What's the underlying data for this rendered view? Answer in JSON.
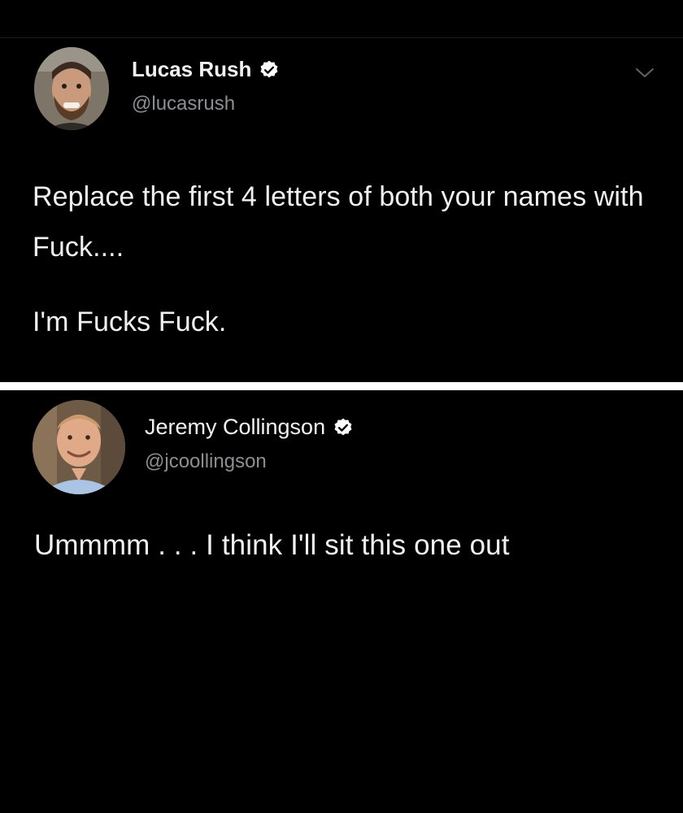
{
  "tweets": [
    {
      "display_name": "Lucas Rush",
      "handle": "@lucasrush",
      "verified": true,
      "text_lines": [
        "Replace the first 4 letters of both your names with Fuck....",
        "I'm Fucks Fuck."
      ]
    },
    {
      "display_name": "Jeremy Collingson",
      "handle": "@jcoollingson",
      "verified": true,
      "text_lines": [
        "Ummmm . . . I think I'll sit this one out"
      ]
    }
  ],
  "colors": {
    "background": "#000000",
    "text": "#f0f0f0",
    "handle": "#8b8f93",
    "divider": "#ffffff",
    "verified_badge": "#ffffff"
  },
  "icons": [
    "verified-badge-icon",
    "chevron-down-icon"
  ]
}
